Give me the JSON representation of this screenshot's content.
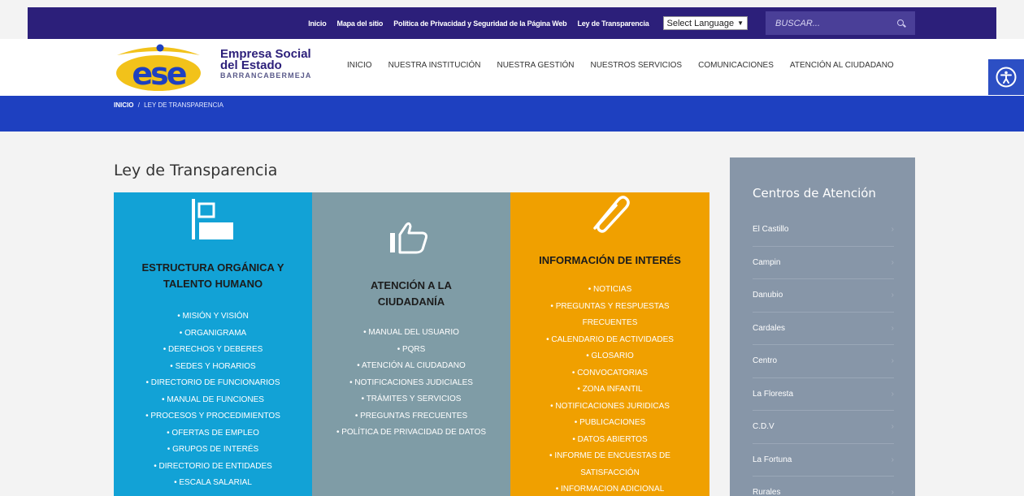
{
  "topbar": {
    "links": [
      "Inicio",
      "Mapa del sitio",
      "Política de Privacidad y Seguridad de la Página Web",
      "Ley de Transparencia"
    ],
    "language": "Select Language",
    "search_placeholder": "BUSCAR..."
  },
  "brand": {
    "logo_text": "ese",
    "line1": "Empresa Social",
    "line2": "del Estado",
    "line3": "BARRANCABERMEJA"
  },
  "nav": [
    "INICIO",
    "NUESTRA INSTITUCIÓN",
    "NUESTRA GESTIÓN",
    "NUESTROS SERVICIOS",
    "COMUNICACIONES",
    "ATENCIÓN AL CIUDADANO"
  ],
  "breadcrumb": {
    "home": "INICIO",
    "separator": "/",
    "current": "LEY DE TRANSPARENCIA"
  },
  "page_title": "Ley de Transparencia",
  "cards": [
    {
      "icon": "organization-chart-icon",
      "color": "#12a2d6",
      "title_lines": [
        "ESTRUCTURA ORGÁNICA Y",
        "TALENTO HUMANO"
      ],
      "items": [
        "MISIÓN Y VISIÓN",
        "ORGANIGRAMA",
        "DERECHOS Y DEBERES",
        "SEDES Y HORARIOS",
        "DIRECTORIO DE FUNCIONARIOS",
        "MANUAL DE FUNCIONES",
        "PROCESOS Y PROCEDIMIENTOS",
        "OFERTAS DE EMPLEO",
        "GRUPOS DE INTERÉS",
        "DIRECTORIO DE ENTIDADES",
        "ESCALA SALARIAL"
      ]
    },
    {
      "icon": "thumbs-up-icon",
      "color": "#7f9ca6",
      "title_lines": [
        "ATENCIÓN A LA",
        "CIUDADANÍA"
      ],
      "items": [
        "MANUAL DEL USUARIO",
        "PQRS",
        "ATENCIÓN AL CIUDADANO",
        "NOTIFICACIONES JUDICIALES",
        "TRÁMITES Y SERVICIOS",
        "PREGUNTAS FRECUENTES",
        "POLÍTICA DE PRIVACIDAD DE DATOS"
      ]
    },
    {
      "icon": "paperclip-icon",
      "color": "#f0a000",
      "title_lines": [
        "INFORMACIÓN DE INTERÉS"
      ],
      "items": [
        "NOTICIAS",
        "PREGUNTAS Y RESPUESTAS FRECUENTES",
        "CALENDARIO DE ACTIVIDADES",
        "GLOSARIO",
        "CONVOCATORIAS",
        "ZONA INFANTIL",
        "NOTIFICACIONES JURIDICAS",
        "PUBLICACIONES",
        "DATOS ABIERTOS",
        "INFORME DE ENCUESTAS DE SATISFACCIÓN",
        "INFORMACION ADICIONAL"
      ]
    }
  ],
  "sidebar": {
    "title": "Centros de Atención",
    "items": [
      "El Castillo",
      "Campin",
      "Danubio",
      "Cardales",
      "Centro",
      "La Floresta",
      "C.D.V",
      "La Fortuna",
      "Rurales"
    ]
  }
}
